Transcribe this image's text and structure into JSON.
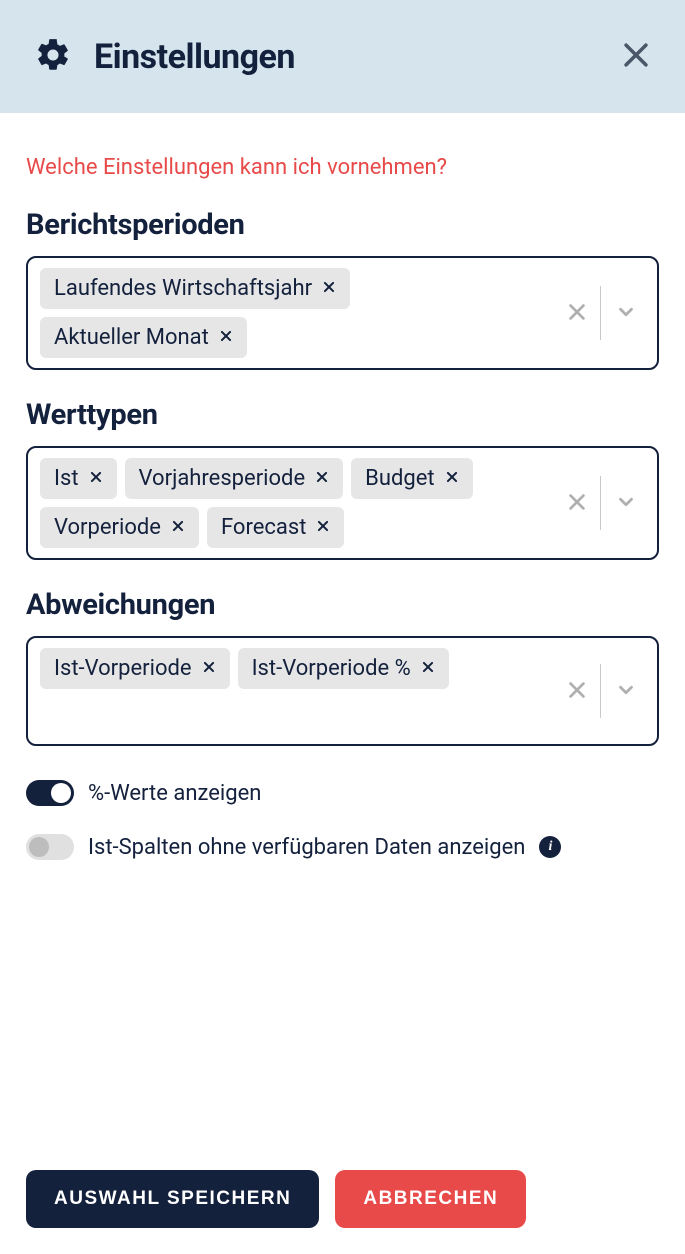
{
  "header": {
    "title": "Einstellungen"
  },
  "help_link": "Welche Einstellungen kann ich vornehmen?",
  "sections": {
    "periods": {
      "title": "Berichtsperioden",
      "chips": [
        "Laufendes Wirtschaftsjahr",
        "Aktueller Monat"
      ]
    },
    "valuetypes": {
      "title": "Werttypen",
      "chips": [
        "Ist",
        "Vorjahresperiode",
        "Budget",
        "Vorperiode",
        "Forecast"
      ]
    },
    "deviations": {
      "title": "Abweichungen",
      "chips": [
        "Ist-Vorperiode",
        "Ist-Vorperiode %"
      ]
    }
  },
  "toggles": {
    "percent": {
      "label": "%-Werte anzeigen",
      "on": true
    },
    "nodata": {
      "label": "Ist-Spalten ohne verfügbaren Daten anzeigen",
      "on": false
    }
  },
  "buttons": {
    "save": "AUSWAHL SPEICHERN",
    "cancel": "ABBRECHEN"
  }
}
